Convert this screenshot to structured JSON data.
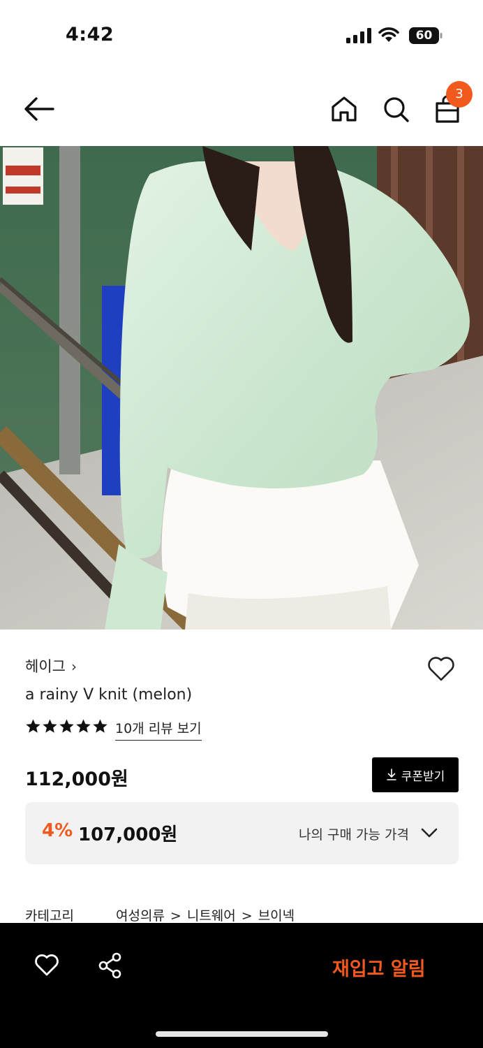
{
  "status_bar": {
    "time": "4:42",
    "battery": "60"
  },
  "nav": {
    "cart_count": "3"
  },
  "product": {
    "brand": "헤이그",
    "brand_chevron": "›",
    "name": "a rainy V knit (melon)",
    "rating": 5,
    "review_link": "10개 리뷰 보기",
    "price": "112,000원",
    "coupon_label": "쿠폰받기",
    "discount_percent": "4%",
    "discount_price": "107,000원",
    "my_price_label": "나의 구매 가능 가격"
  },
  "category": {
    "label": "카테고리",
    "path": [
      "여성의류",
      "니트웨어",
      "브이넥"
    ],
    "separator": ">"
  },
  "bottom_bar": {
    "restock_label": "재입고 알림"
  },
  "colors": {
    "accent": "#f25a1d",
    "dark": "#000000",
    "price_box": "#f2f2f2"
  }
}
